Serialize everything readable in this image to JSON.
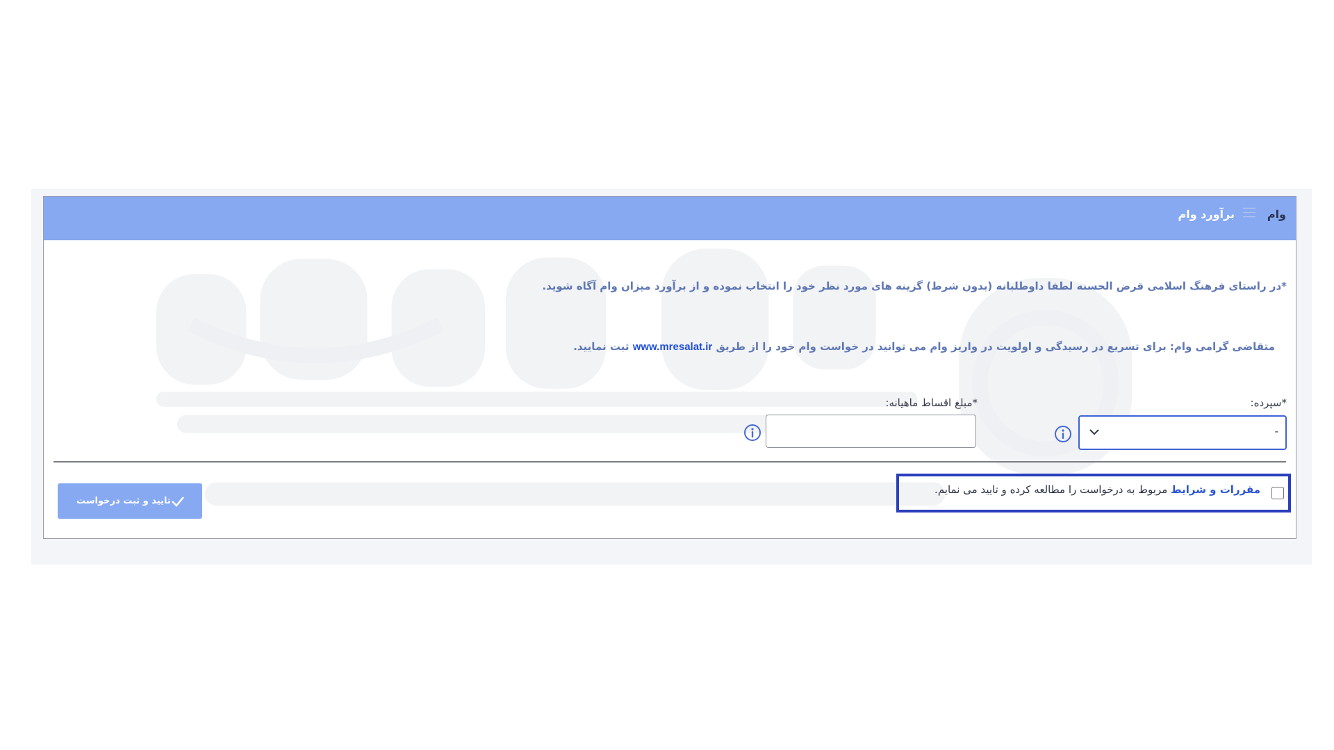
{
  "header": {
    "title": "وام",
    "menu_icon": "menu-icon",
    "subtitle": "برآورد وام"
  },
  "content": {
    "intro": "*در راستای فرهنگ اسلامی قرض الحسنه لطفا داوطلبانه (بدون شرط) گزینه های مورد نظر خود را انتخاب نموده و از برآورد میزان وام آگاه شوید.",
    "notice_prefix": "متقاضی گرامی وام: برای تسریع در رسیدگی و اولویت در واریز وام می توانید در خواست وام خود را از طریق",
    "notice_link": "www.mresalat.ir",
    "notice_suffix": "ثبت نمایید."
  },
  "form": {
    "deposit_label": "*سپرده:",
    "deposit_value": "-",
    "installment_label": "*مبلغ اقساط ماهیانه:",
    "installment_value": "",
    "info_icon": "info-icon",
    "chevron_icon": "chevron-down-icon"
  },
  "terms": {
    "link": "مقررات و شرایط",
    "text": "مربوط به درخواست را مطالعه کرده و تایید می نمایم."
  },
  "actions": {
    "submit_label": "تایید و ثبت درخواست",
    "check_icon": "check-icon"
  },
  "colors": {
    "header": "#86a9f2",
    "primary_blue": "#3f63d8",
    "highlight_border": "#2a3fbd",
    "button_disabled": "#86a9f2"
  }
}
